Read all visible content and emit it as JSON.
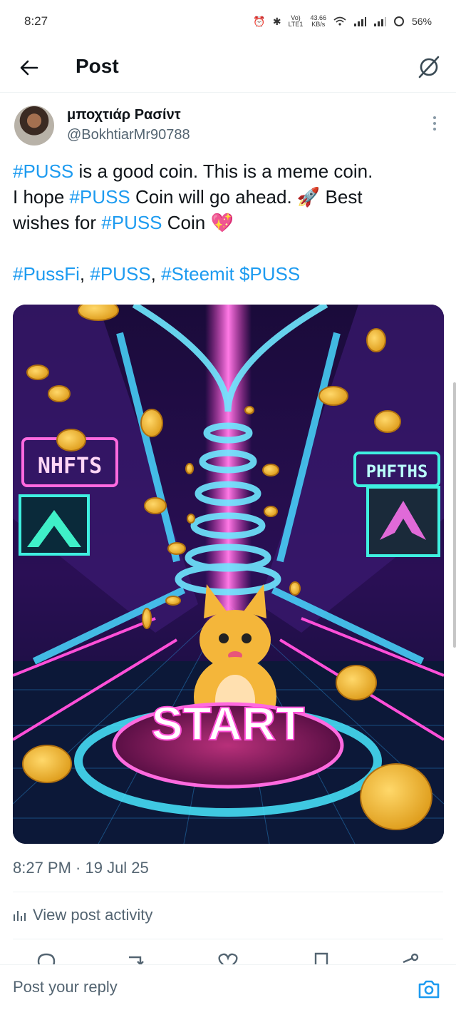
{
  "status_bar": {
    "time": "8:27",
    "net_top": "Vo)",
    "net_bottom": "LTE1",
    "speed_top": "43.66",
    "speed_bottom": "KB/s",
    "battery": "56%"
  },
  "header": {
    "title": "Post"
  },
  "author": {
    "display_name": "μποχτιάρ Ρασίντ",
    "handle": "@BokhtiarMr90788"
  },
  "post": {
    "line1_tag": "#PUSS",
    "line1_text": " is a good coin. This is a meme coin.",
    "line2_pre": "I hope ",
    "line2_tag": "#PUSS",
    "line2_text": " Coin will go ahead. 🚀 Best",
    "line3_pre": "wishes for ",
    "line3_tag": "#PUSS",
    "line3_text": " Coin 💖",
    "tags": [
      "#PussFi",
      "#PUSS",
      "#Steemit",
      "$PUSS"
    ]
  },
  "media": {
    "sign_left": "NHFTS",
    "sign_right": "PHFTHS",
    "button_label": "START"
  },
  "timestamp": "8:27 PM · 19 Jul 25",
  "view_activity": "View post activity",
  "reply_placeholder": "Post your reply",
  "colors": {
    "accent": "#1d9bf0",
    "secondary_text": "#536471"
  }
}
